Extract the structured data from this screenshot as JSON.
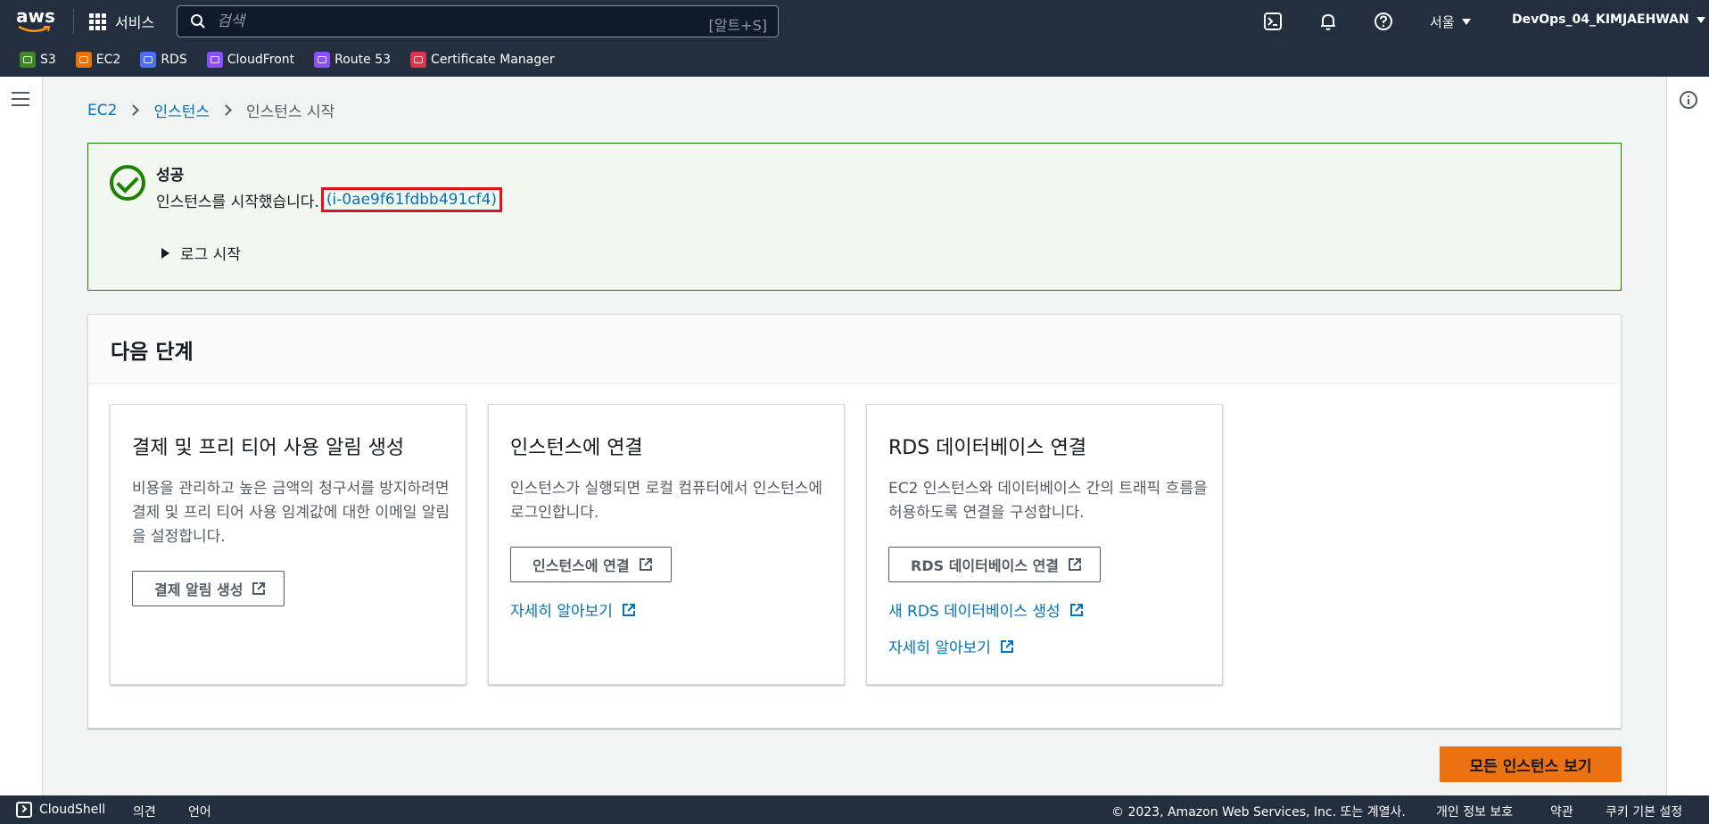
{
  "topnav": {
    "logo_text": "aws",
    "services_label": "서비스",
    "search_placeholder": "검색",
    "search_shortcut": "[알트+S]",
    "region": "서울",
    "account": "DevOps_04_KIMJAEHWAN"
  },
  "favorites": [
    {
      "label": "S3",
      "color": "#3f8624"
    },
    {
      "label": "EC2",
      "color": "#ed7100"
    },
    {
      "label": "RDS",
      "color": "#4d6bfe"
    },
    {
      "label": "CloudFront",
      "color": "#8c4fff"
    },
    {
      "label": "Route 53",
      "color": "#8c4fff"
    },
    {
      "label": "Certificate Manager",
      "color": "#dd344c"
    }
  ],
  "breadcrumb": {
    "items": [
      "EC2",
      "인스턴스"
    ],
    "current": "인스턴스 시작"
  },
  "alert": {
    "title": "성공",
    "message": "인스턴스를 시작했습니다.",
    "instance_id": "(i-0ae9f61fdbb491cf4)",
    "log_toggle": "로그 시작"
  },
  "next_steps": {
    "title": "다음 단계",
    "cards": [
      {
        "title": "결제 및 프리 티어 사용 알림 생성",
        "description": "비용을 관리하고 높은 금액의 청구서를 방지하려면 결제 및 프리 티어 사용 임계값에 대한 이메일 알림을 설정합니다.",
        "button": "결제 알림 생성"
      },
      {
        "title": "인스턴스에 연결",
        "description": "인스턴스가 실행되면 로컬 컴퓨터에서 인스턴스에 로그인합니다.",
        "button": "인스턴스에 연결",
        "links": [
          "자세히 알아보기"
        ]
      },
      {
        "title": "RDS 데이터베이스 연결",
        "description": "EC2 인스턴스와 데이터베이스 간의 트래픽 흐름을 허용하도록 연결을 구성합니다.",
        "button": "RDS 데이터베이스 연결",
        "links": [
          "새 RDS 데이터베이스 생성",
          "자세히 알아보기"
        ]
      }
    ]
  },
  "primary_button": "모든 인스턴스 보기",
  "footer": {
    "cloudshell": "CloudShell",
    "feedback": "의견",
    "language": "언어",
    "copyright": "© 2023, Amazon Web Services, Inc. 또는 계열사.",
    "privacy": "개인 정보 보호",
    "terms": "약관",
    "cookies": "쿠키 기본 설정"
  },
  "colors": {
    "nav_bg": "#232f3e",
    "link": "#0073bb",
    "success": "#1d8102",
    "primary": "#ec7211",
    "highlight": "#e0131c"
  }
}
